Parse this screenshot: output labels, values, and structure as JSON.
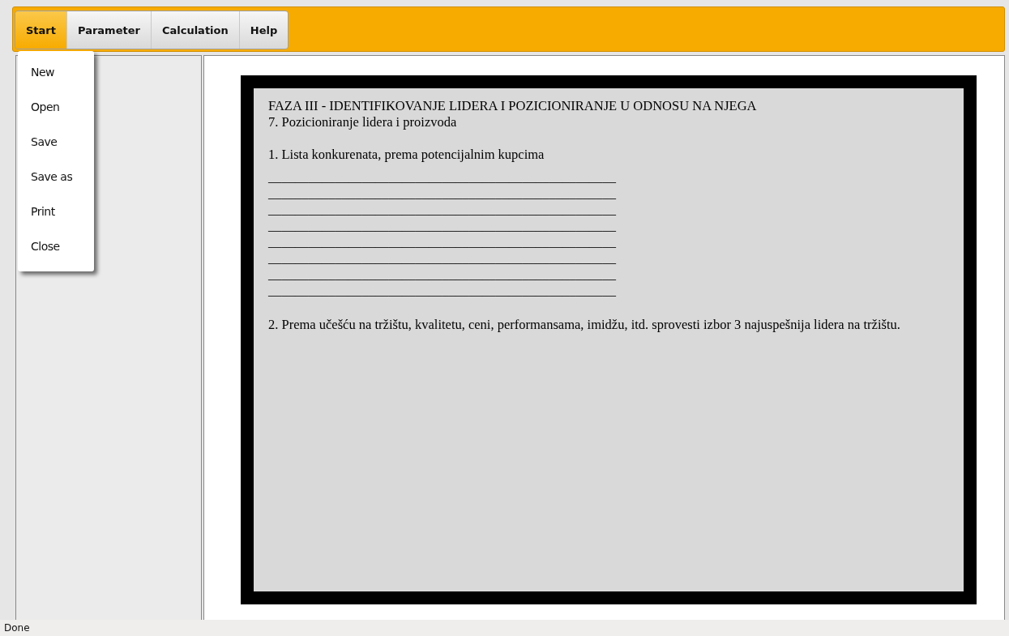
{
  "menubar": [
    {
      "label": "Start",
      "selected": true
    },
    {
      "label": "Parameter",
      "selected": false
    },
    {
      "label": "Calculation",
      "selected": false
    },
    {
      "label": "Help",
      "selected": false
    }
  ],
  "dropdown": {
    "items": [
      "New",
      "Open",
      "Save",
      "Save as",
      "Print",
      "Close"
    ]
  },
  "document": {
    "lines": [
      {
        "kind": "text",
        "text": "FAZA III - IDENTIFIKOVANJE LIDERA I POZICIONIRANJE U ODNOSU NA NJEGA"
      },
      {
        "kind": "text",
        "text": "7. Pozicioniranje lidera i proizvoda"
      },
      {
        "kind": "blank"
      },
      {
        "kind": "text",
        "text": "1. Lista konkurenata, prema potencijalnim kupcima"
      },
      {
        "kind": "blank_line",
        "text": "____________________________________________________"
      },
      {
        "kind": "blank_line",
        "text": "____________________________________________________"
      },
      {
        "kind": "blank_line",
        "text": "____________________________________________________"
      },
      {
        "kind": "blank_line",
        "text": "____________________________________________________"
      },
      {
        "kind": "blank_line",
        "text": "____________________________________________________"
      },
      {
        "kind": "blank_line",
        "text": "____________________________________________________"
      },
      {
        "kind": "blank_line",
        "text": "____________________________________________________"
      },
      {
        "kind": "blank_line",
        "text": "____________________________________________________"
      },
      {
        "kind": "blank"
      },
      {
        "kind": "text",
        "text": "2. Prema učešću na tržištu, kvalitetu, ceni, performansama, imidžu, itd. sprovesti izbor 3 najuspešnija lidera na tržištu."
      }
    ]
  },
  "status_bar": {
    "text": "Done"
  }
}
